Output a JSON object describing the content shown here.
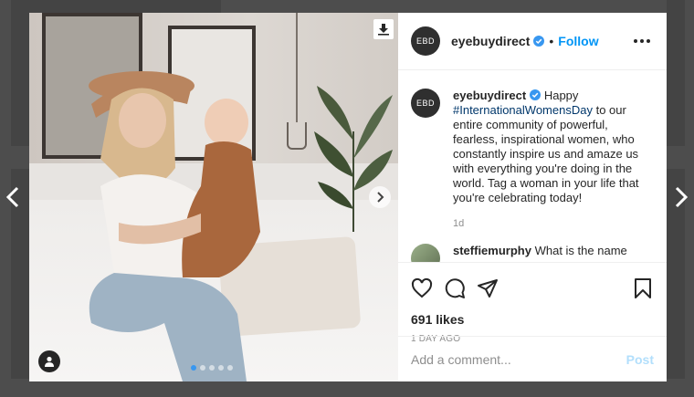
{
  "post": {
    "account": {
      "avatar_initials": "EBD",
      "username": "eyebuydirect",
      "verified": true,
      "follow_label": "Follow",
      "separator": "•"
    },
    "caption": {
      "username": "eyebuydirect",
      "text_before": "Happy",
      "hashtag": "#InternationalWomensDay",
      "text_after": "to our entire community of powerful, fearless, inspirational women, who constantly inspire us and amaze us with everything you're doing in the world. Tag a woman in your life that you're celebrating today!",
      "time": "1d"
    },
    "comments": [
      {
        "username": "steffiemurphy",
        "text": "What is the name"
      }
    ],
    "likes": "691 likes",
    "time_ago": "1 DAY AGO",
    "add_comment": {
      "placeholder": "Add a comment...",
      "post_label": "Post"
    },
    "carousel": {
      "slides": 5,
      "active_index": 0
    }
  },
  "colors": {
    "link_blue": "#0095f6",
    "hashtag": "#00376b",
    "verified": "#3897f0",
    "muted": "#8e8e8e",
    "post_disabled": "#b2dffc"
  },
  "icons": [
    "chevron-left-icon",
    "chevron-right-icon",
    "download-icon",
    "next-photo-icon",
    "user-tag-icon",
    "more-icon",
    "verified-icon",
    "heart-icon",
    "comment-icon",
    "share-icon",
    "bookmark-icon"
  ]
}
